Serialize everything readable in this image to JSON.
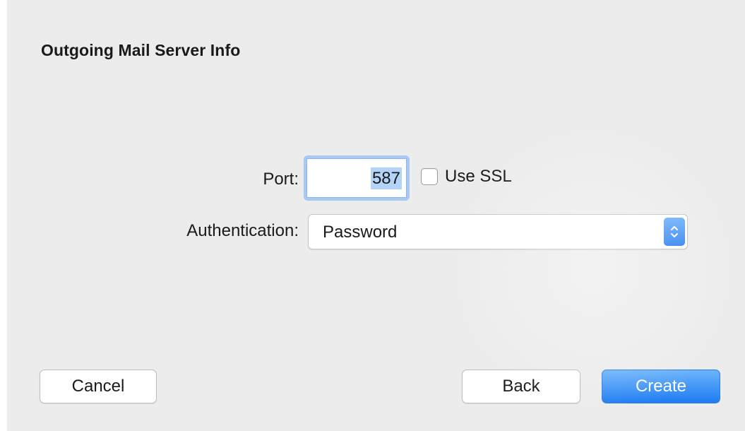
{
  "dialog": {
    "title": "Outgoing Mail Server Info"
  },
  "port": {
    "label": "Port:",
    "value": "587"
  },
  "ssl": {
    "label": "Use SSL",
    "checked": false
  },
  "authentication": {
    "label": "Authentication:",
    "selected": "Password"
  },
  "buttons": {
    "cancel": "Cancel",
    "back": "Back",
    "create": "Create"
  },
  "colors": {
    "accent": "#2a7fee",
    "focus_ring": "#a9c9f5",
    "sheet_background": "#ececec"
  },
  "icons": {
    "select_arrows": "up-down-chevron-icon"
  }
}
